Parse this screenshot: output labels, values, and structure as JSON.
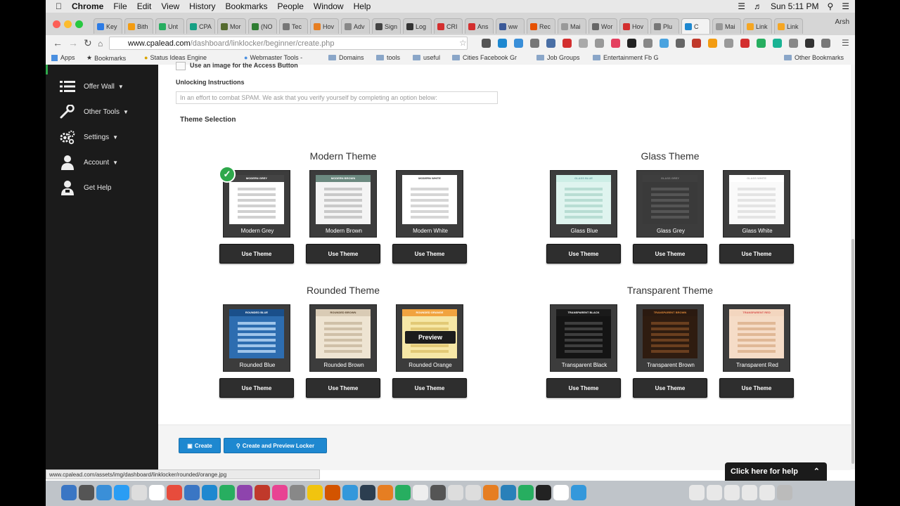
{
  "menubar": {
    "app": "Chrome",
    "items": [
      "File",
      "Edit",
      "View",
      "History",
      "Bookmarks",
      "People",
      "Window",
      "Help"
    ],
    "clock": "Sun 5:11 PM"
  },
  "tabs": [
    "Key",
    "Bith",
    "Unt",
    "CPA",
    "Mor",
    "(NO",
    "Tec",
    "Hov",
    "Adv",
    "Sign",
    "Log",
    "CRI",
    "Ans",
    "ww",
    "Rec",
    "Mai",
    "Wor",
    "Hov",
    "Plu",
    "C",
    "Mai",
    "Link",
    "Link"
  ],
  "profile": "Arsh",
  "address": {
    "host": "www.cpalead.com",
    "path": "/dashboard/linklocker/beginner/create.php"
  },
  "bookmarks": [
    "Apps",
    "Bookmarks",
    "Status Ideas Engine",
    "Webmaster Tools -",
    "Domains",
    "tools",
    "useful",
    "Cities Facebook Gr",
    "Job Groups",
    "Entertainment Fb G",
    "Other Bookmarks"
  ],
  "sidebar": {
    "items": [
      {
        "label": "Offer Wall",
        "has_caret": true
      },
      {
        "label": "Other Tools",
        "has_caret": true
      },
      {
        "label": "Settings",
        "has_caret": true
      },
      {
        "label": "Account",
        "has_caret": true
      },
      {
        "label": "Get Help",
        "has_caret": false
      }
    ]
  },
  "form": {
    "checkbox_label": "Use an image for the Access Button",
    "unlocking_label": "Unlocking Instructions",
    "unlocking_placeholder": "In an effort to combat SPAM. We ask that you verify yourself by completing an option below:",
    "theme_selection_label": "Theme Selection"
  },
  "theme_groups": [
    {
      "title": "Modern Theme",
      "themes": [
        {
          "name": "Modern Grey",
          "header": "MODERN GREY",
          "frame": "#3c3c3c",
          "hdr_color": "#444444",
          "hdr_text": "#ffffff",
          "body": "#ffffff",
          "row": "#d0d0d0",
          "selected": true
        },
        {
          "name": "Modern Brown",
          "header": "MODERN BROWN",
          "frame": "#3c3c3c",
          "hdr_color": "#6c8a80",
          "hdr_text": "#ffffff",
          "body": "#f4f4f4",
          "row": "#c9c9c9",
          "selected": false
        },
        {
          "name": "Modern White",
          "header": "MODERN WHITE",
          "frame": "#3c3c3c",
          "hdr_color": "#ffffff",
          "hdr_text": "#333333",
          "body": "#ffffff",
          "row": "#d6d6d6",
          "selected": false
        }
      ]
    },
    {
      "title": "Glass Theme",
      "themes": [
        {
          "name": "Glass Blue",
          "header": "GLASS BLUE",
          "frame": "#3c3c3c",
          "hdr_color": "#cdeee6",
          "hdr_text": "#7aa",
          "body": "#dff4ef",
          "row": "#b8ddd3",
          "selected": false
        },
        {
          "name": "Glass Grey",
          "header": "GLASS GREY",
          "frame": "#3c3c3c",
          "hdr_color": "#3e3e3e",
          "hdr_text": "#888888",
          "body": "#3a3a3a",
          "row": "#555555",
          "selected": false
        },
        {
          "name": "Glass White",
          "header": "GLASS WHITE",
          "frame": "#3c3c3c",
          "hdr_color": "#ffffff",
          "hdr_text": "#bbbbbb",
          "body": "#fafafa",
          "row": "#e4e4e4",
          "selected": false
        }
      ]
    },
    {
      "title": "Rounded Theme",
      "themes": [
        {
          "name": "Rounded Blue",
          "header": "ROUNDED BLUE",
          "frame": "#3c3c3c",
          "hdr_color": "#1a4f8a",
          "hdr_text": "#ffffff",
          "body": "#2d6db0",
          "row": "#9fc5ea",
          "selected": false
        },
        {
          "name": "Rounded Brown",
          "header": "ROUNDED BROWN",
          "frame": "#3c3c3c",
          "hdr_color": "#d9cbb5",
          "hdr_text": "#5a4630",
          "body": "#eee4d2",
          "row": "#cfc0a8",
          "selected": false
        },
        {
          "name": "Rounded Orange",
          "header": "ROUNDED ORANGE",
          "frame": "#3c3c3c",
          "hdr_color": "#f1a33f",
          "hdr_text": "#ffffff",
          "body": "#f6e7a6",
          "row": "#e2c976",
          "selected": false,
          "preview_label": "Preview"
        }
      ]
    },
    {
      "title": "Transparent Theme",
      "themes": [
        {
          "name": "Transparent Black",
          "header": "TRANSPARENT BLACK",
          "frame": "#3c3c3c",
          "hdr_color": "#1a1a1a",
          "hdr_text": "#ffffff",
          "body": "#141414",
          "row": "#3e3e3e",
          "selected": false
        },
        {
          "name": "Transparent Brown",
          "header": "TRANSPARENT BROWN",
          "frame": "#3c3c3c",
          "hdr_color": "#2b1a10",
          "hdr_text": "#e08a3a",
          "body": "#2f1c10",
          "row": "#6a3f1f",
          "selected": false
        },
        {
          "name": "Transparent Red",
          "header": "TRANSPARENT RED",
          "frame": "#3c3c3c",
          "hdr_color": "#f3d6bf",
          "hdr_text": "#d9534f",
          "body": "#f5dcc7",
          "row": "#e0b896",
          "selected": false
        }
      ]
    }
  ],
  "use_theme_label": "Use Theme",
  "buttons": {
    "create": "Create",
    "create_preview": "Create and Preview Locker"
  },
  "status_url": "www.cpalead.com/assets/img/dashboard/linklocker/rounded/orange.jpg",
  "help_tab": "Click here for help",
  "colors": {
    "sidebar_bg": "#1b1b1b",
    "accent_blue": "#1e88d0",
    "check_green": "#2ea84b"
  }
}
